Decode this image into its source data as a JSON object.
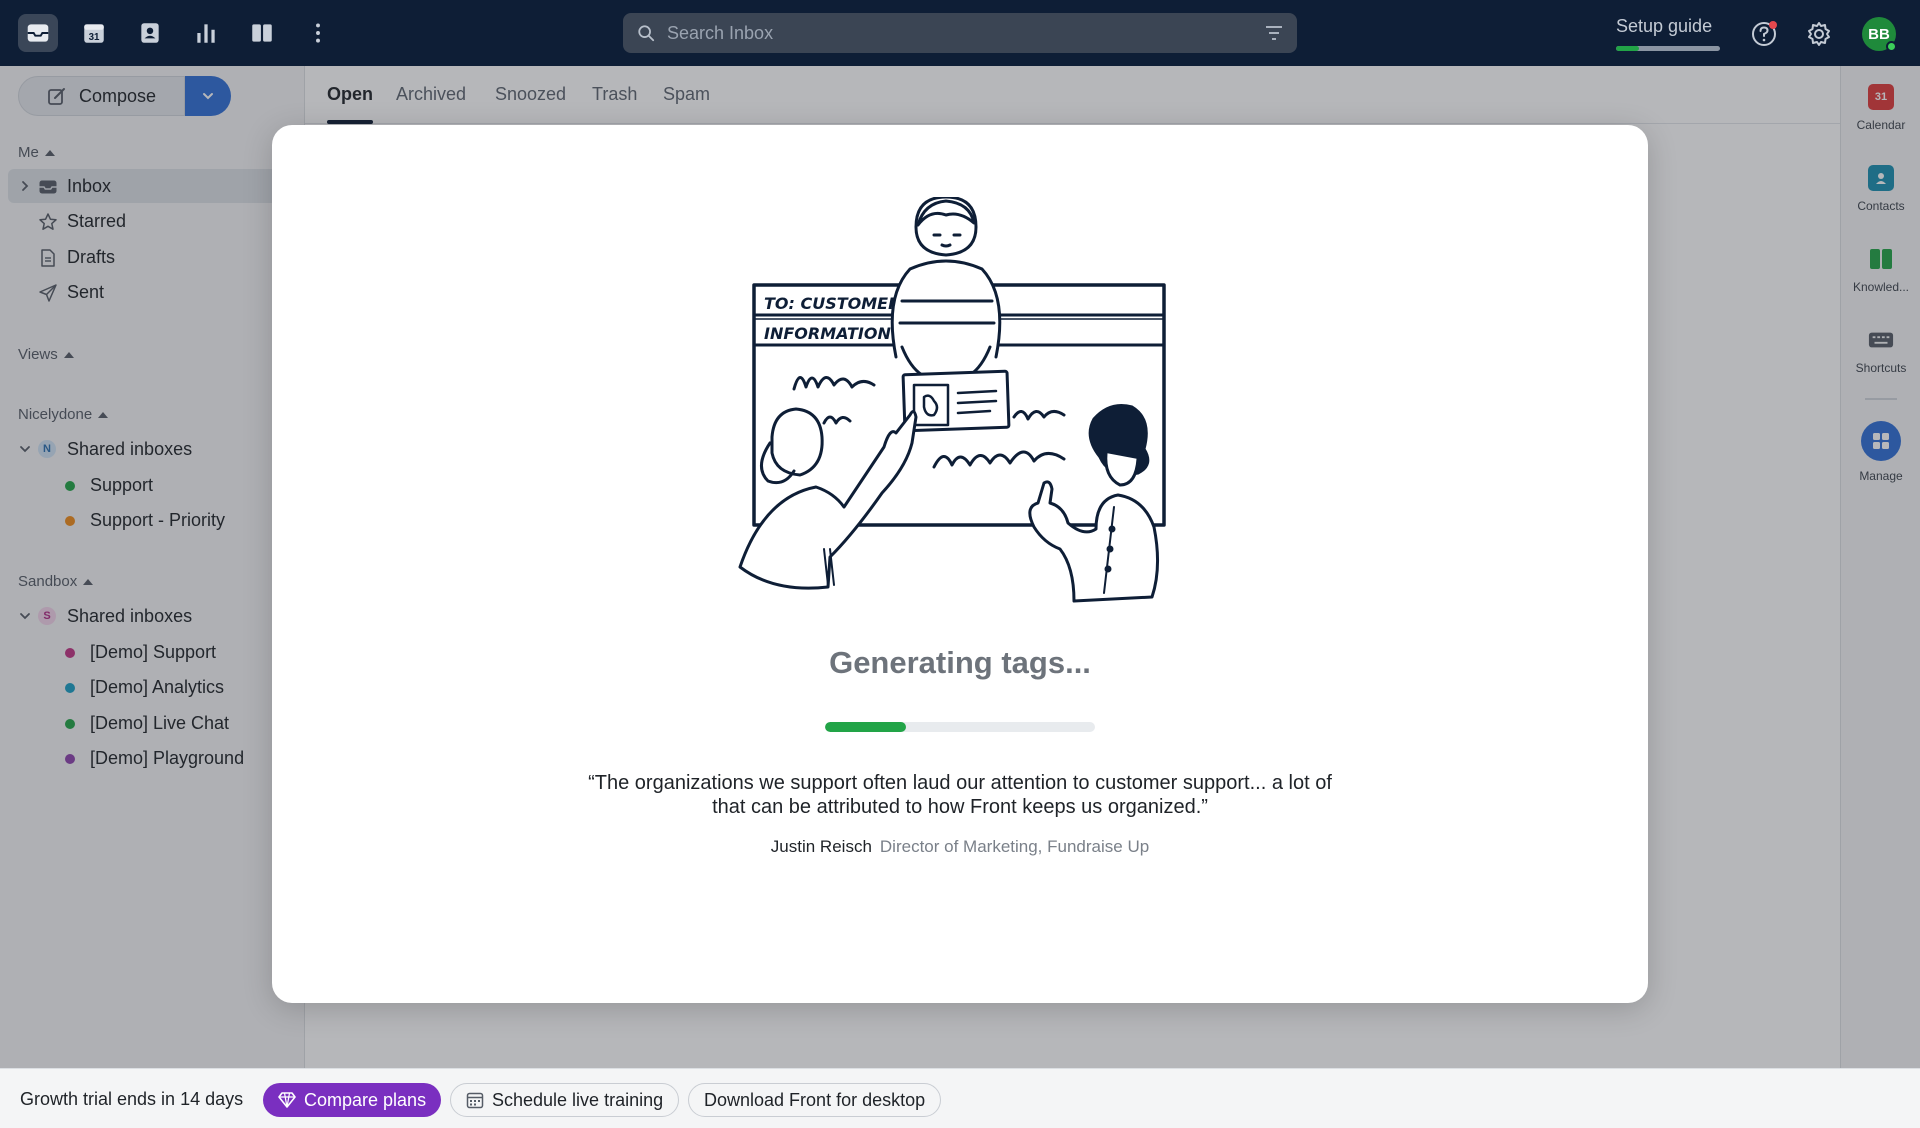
{
  "topbar": {
    "search_placeholder": "Search Inbox",
    "setup_label": "Setup guide",
    "setup_progress": 0.22,
    "avatar_initials": "BB",
    "icons": [
      "inbox-icon",
      "calendar-icon",
      "contacts-icon",
      "analytics-icon",
      "knowledge-base-icon",
      "more-icon"
    ]
  },
  "sidebar": {
    "compose_label": "Compose",
    "me_header": "Me",
    "me_items": [
      {
        "label": "Inbox"
      },
      {
        "label": "Starred"
      },
      {
        "label": "Drafts"
      },
      {
        "label": "Sent"
      }
    ],
    "views_header": "Views",
    "workspace1": {
      "header": "Nicelydone",
      "group_label": "Shared inboxes",
      "group_letter": "N",
      "items": [
        {
          "label": "Support",
          "color": "#22a447"
        },
        {
          "label": "Support - Priority",
          "color": "#f08c1a"
        }
      ]
    },
    "workspace2": {
      "header": "Sandbox",
      "group_label": "Shared inboxes",
      "group_letter": "S",
      "items": [
        {
          "label": "[Demo] Support",
          "color": "#c13584"
        },
        {
          "label": "[Demo] Analytics",
          "color": "#1b9fc4"
        },
        {
          "label": "[Demo] Live Chat",
          "color": "#22a447"
        },
        {
          "label": "[Demo] Playground",
          "color": "#8e44ad"
        }
      ]
    }
  },
  "tabs": [
    "Open",
    "Archived",
    "Snoozed",
    "Trash",
    "Spam"
  ],
  "rail": {
    "items": [
      {
        "label": "Calendar"
      },
      {
        "label": "Contacts"
      },
      {
        "label": "Knowled..."
      },
      {
        "label": "Shortcuts"
      },
      {
        "label": "Manage"
      }
    ],
    "calendar_day": "31"
  },
  "bottombar": {
    "trial_text": "Growth trial ends in 14 days",
    "compare_label": "Compare plans",
    "training_label": "Schedule live training",
    "download_label": "Download Front for desktop"
  },
  "modal": {
    "title": "Generating tags...",
    "progress": 0.3,
    "quote": "“The organizations we support often laud our attention to customer support... a lot of that can be attributed to how Front keeps us organized.”",
    "author": "Justin Reisch",
    "role": "Director of Marketing, Fundraise Up",
    "illustration_text_1": "TO: CUSTOMER",
    "illustration_text_2": "INFORMATION"
  },
  "colors": {
    "topbar": "#0e1e36",
    "accent_blue": "#2f6fd6",
    "progress_green": "#22a447",
    "compare_purple": "#7a2fc0"
  }
}
